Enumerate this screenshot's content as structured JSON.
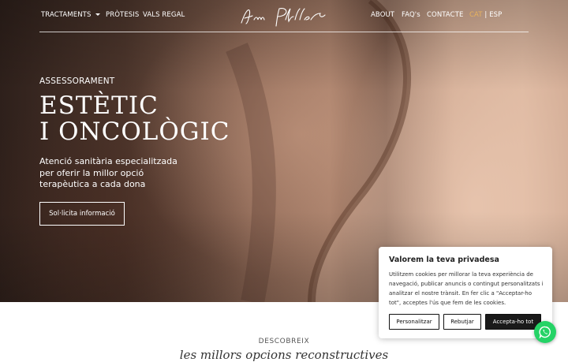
{
  "nav": {
    "left": [
      {
        "label": "TRACTAMENTS",
        "has_dropdown": true
      },
      {
        "label": "PRÒTESIS"
      },
      {
        "label": "VALS REGAL"
      }
    ],
    "right": [
      {
        "label": "ABOUT"
      },
      {
        "label": "FAQ's"
      },
      {
        "label": "CONTACTE"
      }
    ],
    "lang": {
      "active": "CAT",
      "separator": "|",
      "other": "ESP"
    },
    "accent_color": "#e9b25c",
    "logo_icon": "signature-logo"
  },
  "hero": {
    "eyebrow": "ASSESSORAMENT",
    "title_line1": "ESTÈTIC",
    "title_line2": "I ONCOLÒGIC",
    "subtitle": "Atenció sanitària especialitzada per oferir la millor opció terapèutica a cada dona",
    "cta_label": "Sol·licita informació"
  },
  "section": {
    "eyebrow": "DESCOBREIX",
    "teaser": "les millors opcions reconstructives"
  },
  "cookie": {
    "title": "Valorem la teva privadesa",
    "text": "Utilitzem cookies per millorar la teva experiència de navegació, publicar anuncis o contingut personalitzats i analitzar el nostre trànsit. En fer clic a \"Acceptar-ho tot\", acceptes l'ús que fem de les cookies.",
    "btn_customize": "Personalitzar",
    "btn_reject": "Rebutjar",
    "btn_accept": "Accepta-ho tot"
  },
  "whatsapp": {
    "icon": "whatsapp-icon",
    "color": "#25d366"
  }
}
